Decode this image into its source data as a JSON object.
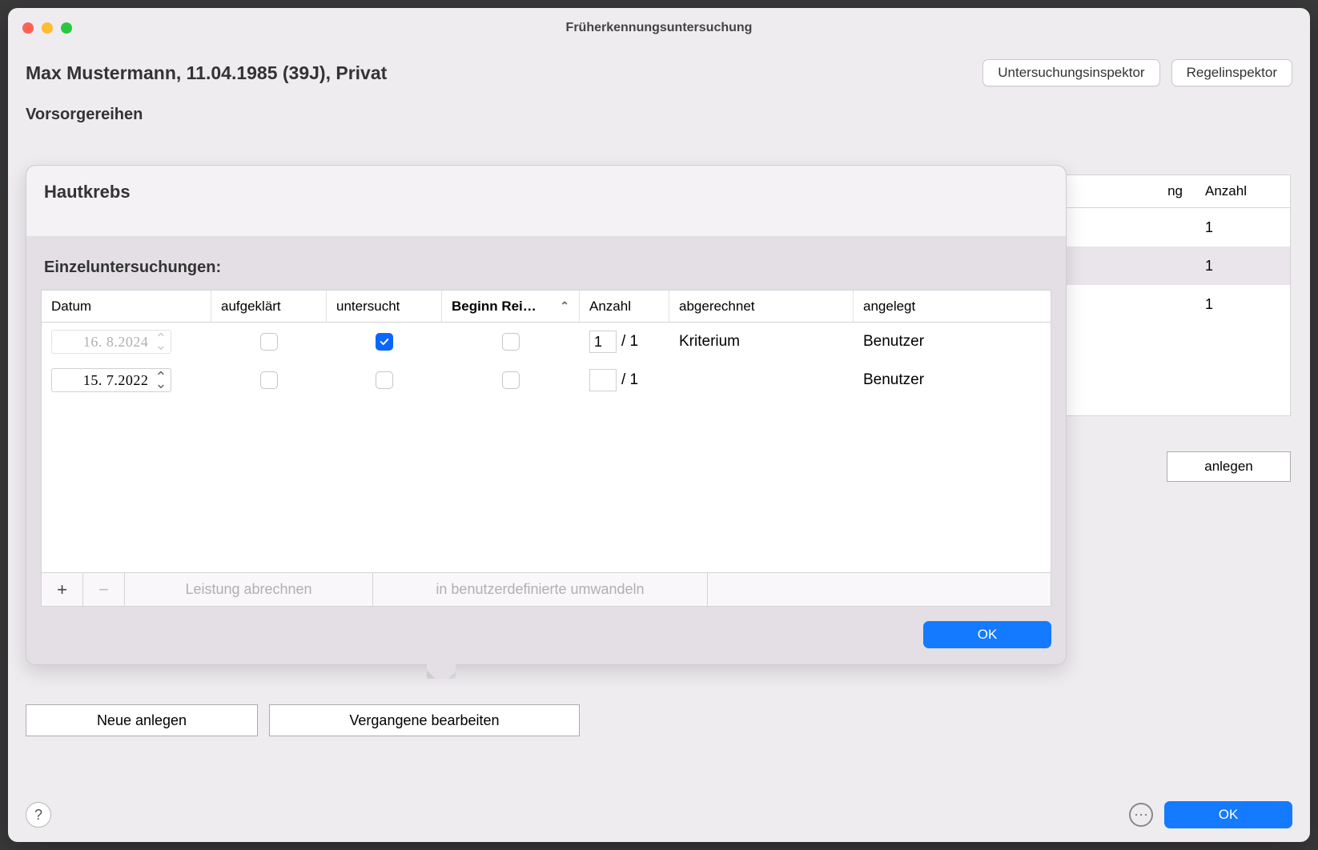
{
  "window": {
    "title": "Früherkennungsuntersuchung"
  },
  "patient": {
    "display": "Max Mustermann, 11.04.1985 (39J), Privat"
  },
  "header_buttons": {
    "inspector": "Untersuchungsinspektor",
    "rules": "Regelinspektor"
  },
  "section": {
    "title": "Vorsorgereihen"
  },
  "bg_table": {
    "col_ext": "ng",
    "col_anzahl": "Anzahl",
    "rows": [
      {
        "anzahl": "1"
      },
      {
        "anzahl": "1"
      },
      {
        "anzahl": "1"
      }
    ],
    "anlegen_btn": "anlegen"
  },
  "popover": {
    "title": "Hautkrebs",
    "sub": "Einzeluntersuchungen:",
    "columns": {
      "datum": "Datum",
      "aufgeklaert": "aufgeklärt",
      "untersucht": "untersucht",
      "beginn": "Beginn Rei…",
      "anzahl": "Anzahl",
      "abgerechnet": "abgerechnet",
      "angelegt": "angelegt"
    },
    "rows": [
      {
        "date": "16.  8.2024",
        "date_disabled": true,
        "aufgeklaert": false,
        "untersucht": true,
        "beginn": false,
        "anzahl_num": "1",
        "anzahl_total": "/ 1",
        "abgerechnet": "Kriterium",
        "angelegt": "Benutzer"
      },
      {
        "date": "15.  7.2022",
        "date_disabled": false,
        "aufgeklaert": false,
        "untersucht": false,
        "beginn": false,
        "anzahl_num": "",
        "anzahl_total": "/ 1",
        "abgerechnet": "",
        "angelegt": "Benutzer"
      }
    ],
    "footer": {
      "leistung": "Leistung abrechnen",
      "convert": "in benutzerdefinierte umwandeln"
    },
    "ok": "OK"
  },
  "main_buttons": {
    "new": "Neue anlegen",
    "edit_past": "Vergangene bearbeiten"
  },
  "footer": {
    "ok": "OK"
  }
}
